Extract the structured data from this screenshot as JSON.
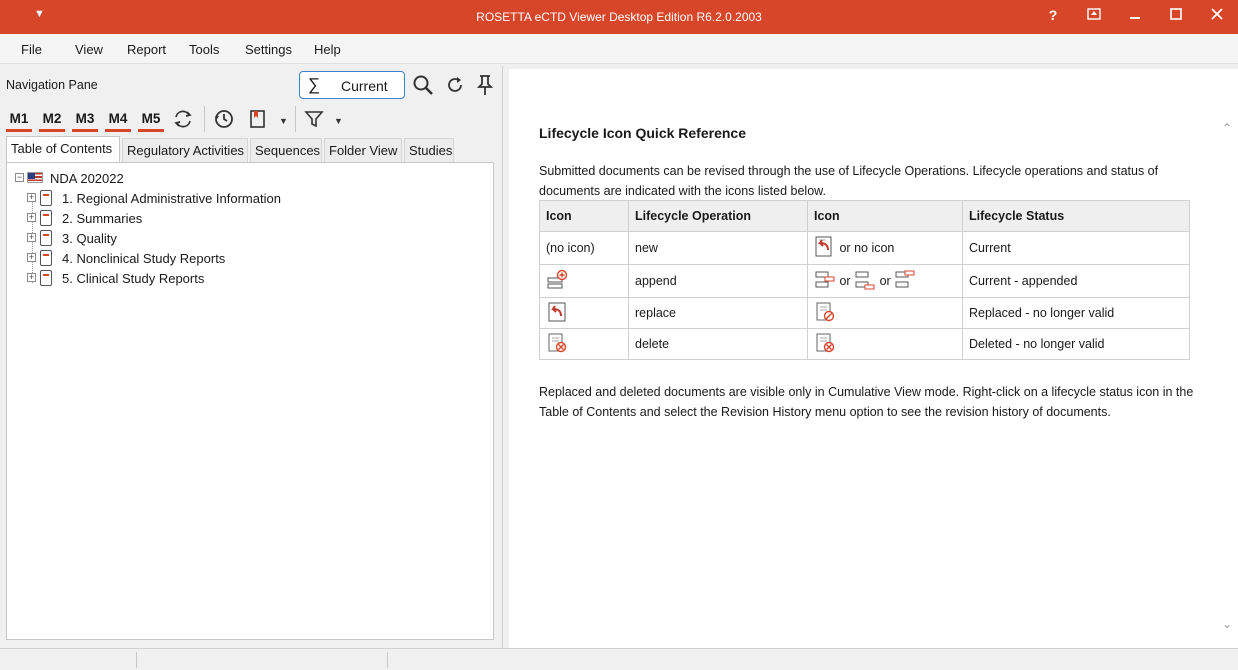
{
  "window": {
    "title": "ROSETTA eCTD Viewer Desktop Edition R6.2.0.2003",
    "help_label": "?"
  },
  "menu": {
    "items": [
      "File",
      "View",
      "Report",
      "Tools",
      "Settings",
      "Help"
    ]
  },
  "nav": {
    "title": "Navigation Pane",
    "view_mode": "Current",
    "module_buttons": [
      "M1",
      "M2",
      "M3",
      "M4",
      "M5"
    ],
    "tabs": [
      "Table of Contents",
      "Regulatory Activities",
      "Sequences",
      "Folder View",
      "Studies"
    ],
    "active_tab": "Table of Contents"
  },
  "tree": {
    "root": "NDA 202022",
    "items": [
      "1. Regional Administrative Information",
      "2. Summaries",
      "3. Quality",
      "4. Nonclinical Study Reports",
      "5. Clinical Study Reports"
    ]
  },
  "reference": {
    "title": "Lifecycle Icon Quick Reference",
    "intro": "Submitted documents can be revised through the use of Lifecycle Operations. Lifecycle operations and status of documents are indicated with the icons listed below.",
    "headers": [
      "Icon",
      "Lifecycle Operation",
      "Icon",
      "Lifecycle Status"
    ],
    "rows": [
      {
        "icon": "(no icon)",
        "operation": "new",
        "status_icon_note": "or no icon",
        "status": "Current"
      },
      {
        "icon": "",
        "operation": "append",
        "or1": "or",
        "or2": "or",
        "status": "Current - appended"
      },
      {
        "icon": "",
        "operation": "replace",
        "status": "Replaced - no longer valid"
      },
      {
        "icon": "",
        "operation": "delete",
        "status": "Deleted - no longer valid"
      }
    ],
    "outro": "Replaced and deleted documents are visible only in Cumulative View mode. Right-click on a lifecycle status icon in the Table of Contents and select the Revision History menu option to see the revision history of documents."
  },
  "colors": {
    "accent": "#d8462a",
    "focus_border": "#3b82c8"
  }
}
